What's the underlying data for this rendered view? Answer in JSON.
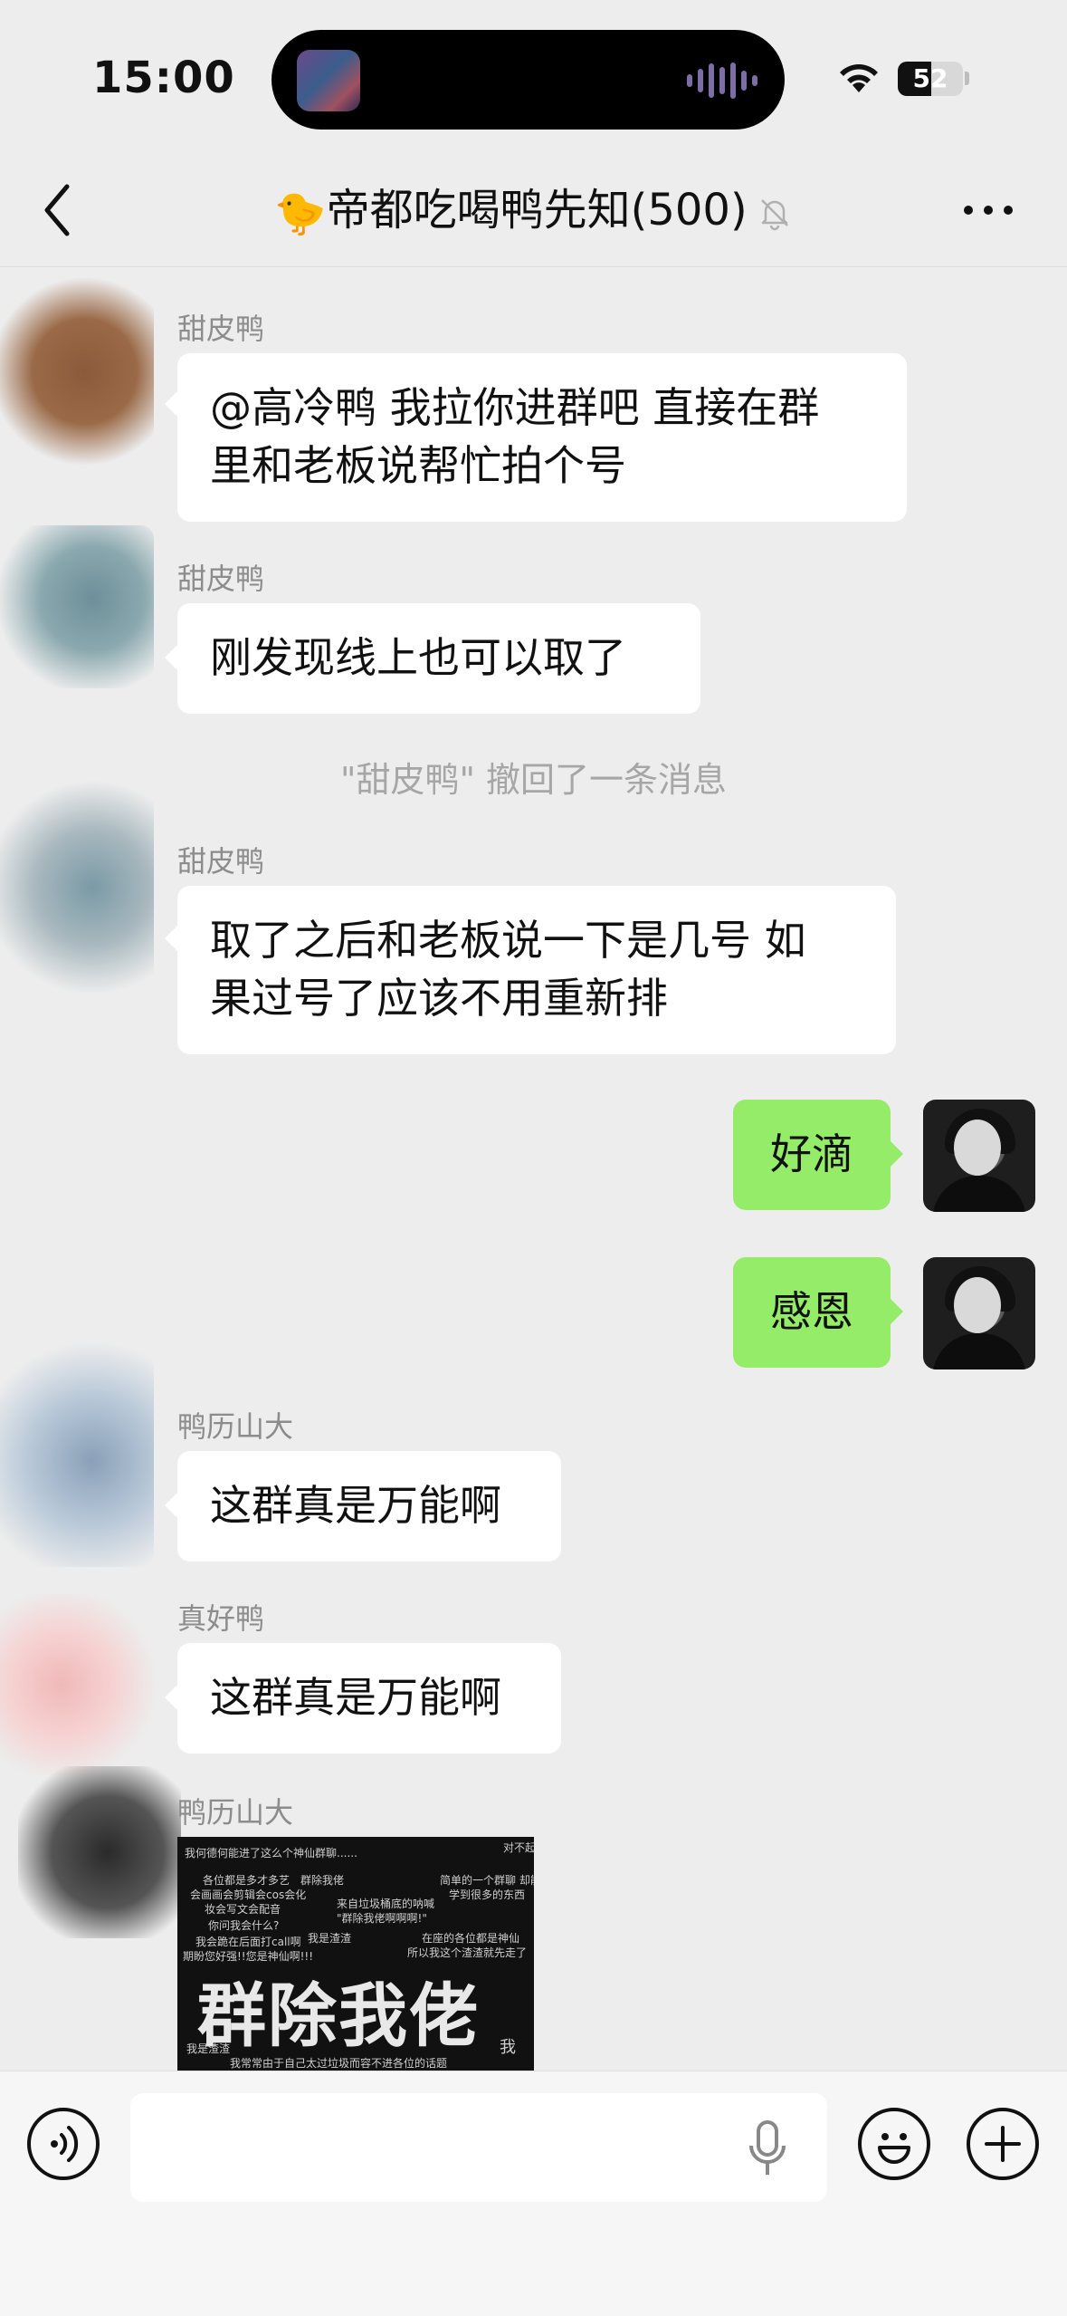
{
  "status_bar": {
    "time": "15:00",
    "battery": "52",
    "battery_level": 0.52
  },
  "header": {
    "title_emoji": "🐤",
    "title": "帝都吃喝鸭先知(500)"
  },
  "messages": [
    {
      "sender": "甜皮鸭",
      "text": "@高冷鸭 我拉你进群吧 直接在群\n里和老板说帮忙拍个号"
    },
    {
      "sender": "甜皮鸭",
      "text": "刚发现线上也可以取了"
    },
    {
      "sender": "甜皮鸭",
      "text": "取了之后和老板说一下是几号 如\n果过号了应该不用重新排"
    },
    {
      "sender": "鸭历山大",
      "text": "这群真是万能啊"
    },
    {
      "sender": "真好鸭",
      "text": "这群真是万能啊"
    },
    {
      "sender": "鸭历山大"
    }
  ],
  "system_notice": "\"甜皮鸭\" 撤回了一条消息",
  "self_messages": [
    {
      "text": "好滴"
    },
    {
      "text": "感恩"
    }
  ],
  "meme": {
    "big_text": "群除我佬",
    "lines": [
      "我何德何能进了这么个神仙群聊......",
      "对不起",
      "各位都是多才多艺",
      "群除我佬",
      "会画画会剪辑会cos会化",
      "妆会写文会配音",
      "来自垃圾桶底的呐喊",
      "\"群除我佬啊啊啊!\"",
      "你问我会什么?",
      "我会跪在后面打call啊",
      "我是渣渣",
      "在座的各位都是神仙",
      "所以我这个渣渣就先走了",
      "简单的一个群聊 却能",
      "学到很多的东西",
      "期盼您好强!!您是神仙啊!!!",
      "我是渣渣",
      "我常常由于自己太过垃圾而容不进各位的话题",
      "我"
    ]
  },
  "input_bar": {
    "placeholder": ""
  }
}
